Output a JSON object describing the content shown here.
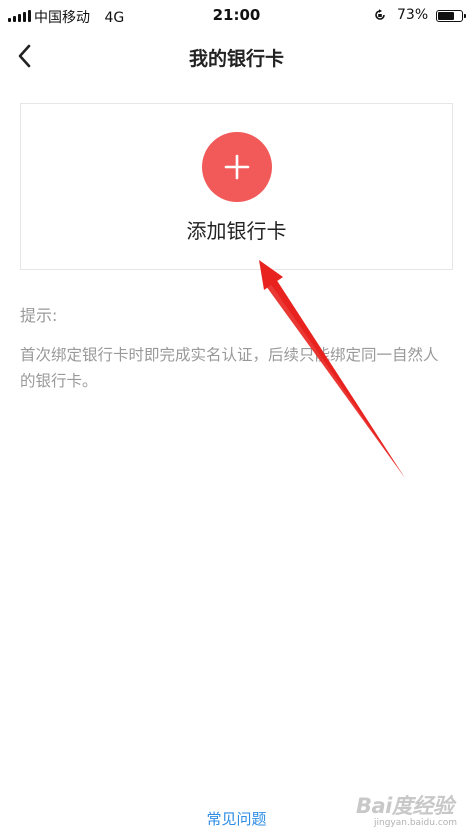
{
  "status_bar": {
    "carrier": "中国移动",
    "network": "4G",
    "time": "21:00",
    "battery_percent_label": "73%",
    "battery_level": 0.73
  },
  "nav": {
    "title": "我的银行卡"
  },
  "add_card": {
    "label": "添加银行卡"
  },
  "tips": {
    "title": "提示:",
    "text": "首次绑定银行卡时即完成实名认证，后续只能绑定同一自然人的银行卡。"
  },
  "footer": {
    "faq_label": "常见问题"
  },
  "watermark": {
    "main": "Bai度经验",
    "sub": "jingyan.baidu.com"
  },
  "colors": {
    "accent": "#f25a5a",
    "link": "#2f8de4",
    "annotation_arrow": "#e8231f",
    "muted_text": "#999999"
  },
  "icons": {
    "back": "chevron-left-icon",
    "add": "plus-icon",
    "rotation_lock": "rotation-lock-icon"
  }
}
